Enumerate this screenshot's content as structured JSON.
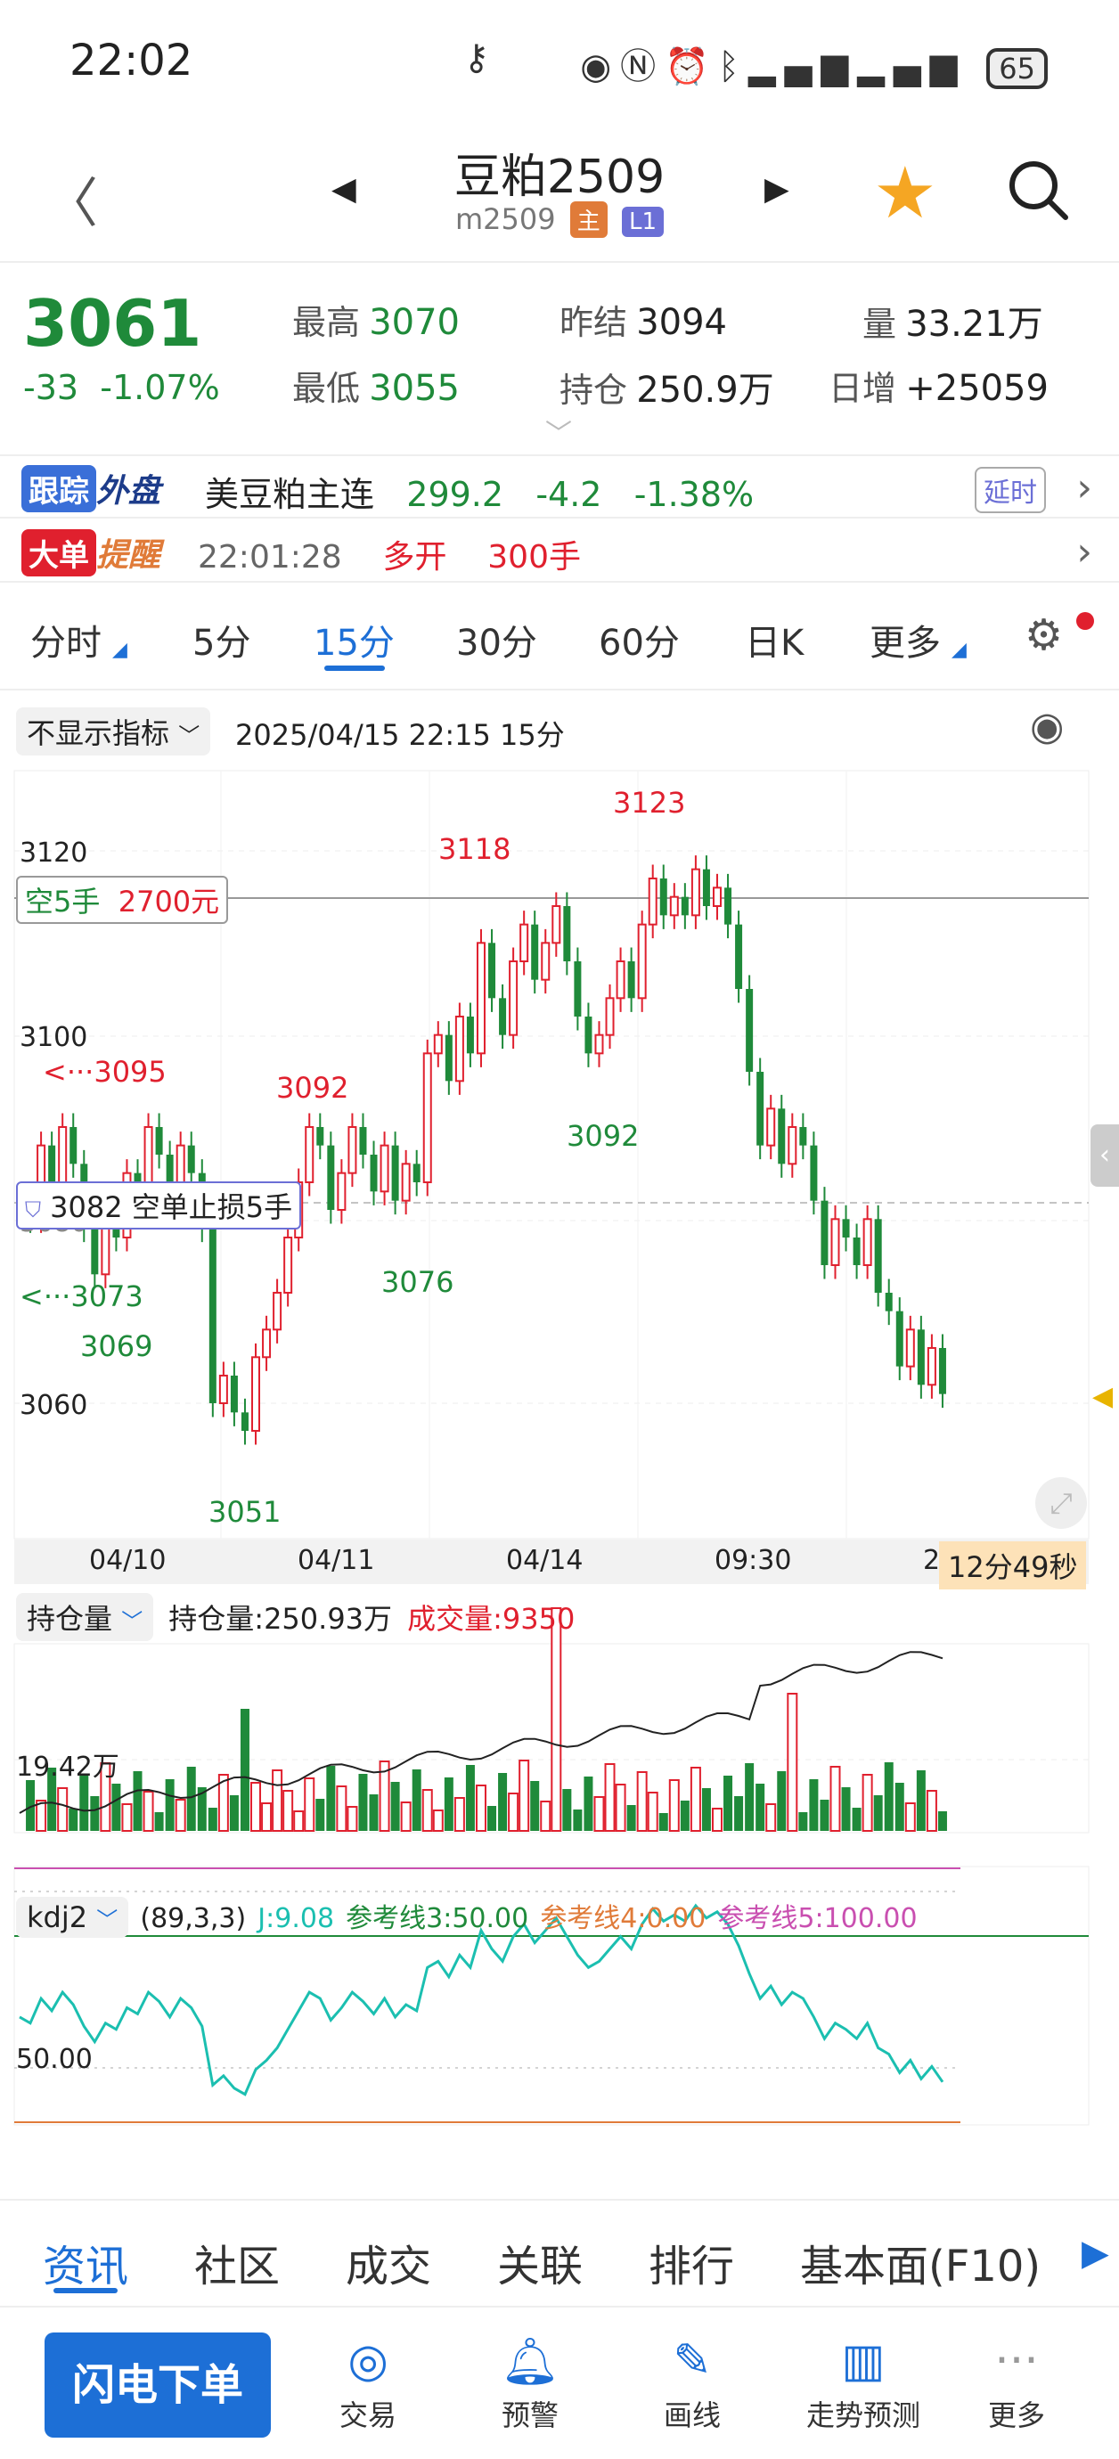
{
  "status": {
    "time": "22:02",
    "battery": "65"
  },
  "header": {
    "title": "豆粕2509",
    "code": "m2509",
    "tag_main": "主",
    "tag_l1": "L1"
  },
  "quote": {
    "price": "3061",
    "change": "-33",
    "change_pct": "-1.07%",
    "high_label": "最高",
    "high": "3070",
    "low_label": "最低",
    "low": "3055",
    "prev_settle_label": "昨结",
    "prev_settle": "3094",
    "oi_label": "持仓",
    "oi": "250.9万",
    "vol_label": "量",
    "vol": "33.21万",
    "daily_inc_label": "日增",
    "daily_inc": "+25059"
  },
  "external": {
    "badge_a": "跟踪",
    "badge_b": "外盘",
    "name": "美豆粕主连",
    "price": "299.2",
    "chg": "-4.2",
    "pct": "-1.38%",
    "delay": "延时"
  },
  "alert": {
    "badge_a": "大单",
    "badge_b": "提醒",
    "time": "22:01:28",
    "type": "多开",
    "qty": "300手"
  },
  "periods": [
    "分时",
    "5分",
    "15分",
    "30分",
    "60分",
    "日K",
    "更多"
  ],
  "active_period": "15分",
  "chart_header": {
    "indicator": "不显示指标",
    "datetime": "2025/04/15 22:15  15分"
  },
  "chart": {
    "y_labels": [
      "3120",
      "3100",
      "3080",
      "3060"
    ],
    "x_labels": [
      "04/10",
      "04/11",
      "04/14",
      "09:30",
      "2"
    ],
    "countdown": "12分49秒",
    "order_short": {
      "label": "空5手",
      "value": "2700元"
    },
    "order_stop": {
      "price": "3082",
      "label": "空单止损5手"
    },
    "annotations": [
      "3123",
      "3118",
      "3095",
      "3092",
      "3092",
      "3073",
      "3069",
      "3076",
      "3051"
    ]
  },
  "sub1": {
    "selector": "持仓量",
    "oi_text": "持仓量:250.93万",
    "vol_text": "成交量:9350",
    "y_label": "19.42万"
  },
  "sub2": {
    "selector": "kdj2",
    "params": "(89,3,3)",
    "j": "J:9.08",
    "ref3": "参考线3:50.00",
    "ref4": "参考线4:0.00",
    "ref5": "参考线5:100.00",
    "y_label": "50.00"
  },
  "info_tabs": [
    "资讯",
    "社区",
    "成交",
    "关联",
    "排行",
    "基本面(F10)"
  ],
  "bottom": {
    "flash": "闪电下单",
    "items": [
      {
        "label": "交易",
        "icon": "trade-icon"
      },
      {
        "label": "预警",
        "icon": "bell-icon"
      },
      {
        "label": "画线",
        "icon": "pen-icon"
      },
      {
        "label": "走势预测",
        "icon": "forecast-icon"
      },
      {
        "label": "更多",
        "icon": "more-icon"
      }
    ]
  },
  "colors": {
    "up": "#e0202e",
    "down": "#1f8a3a",
    "accent": "#1d6fd6",
    "star": "#f5a623"
  }
}
